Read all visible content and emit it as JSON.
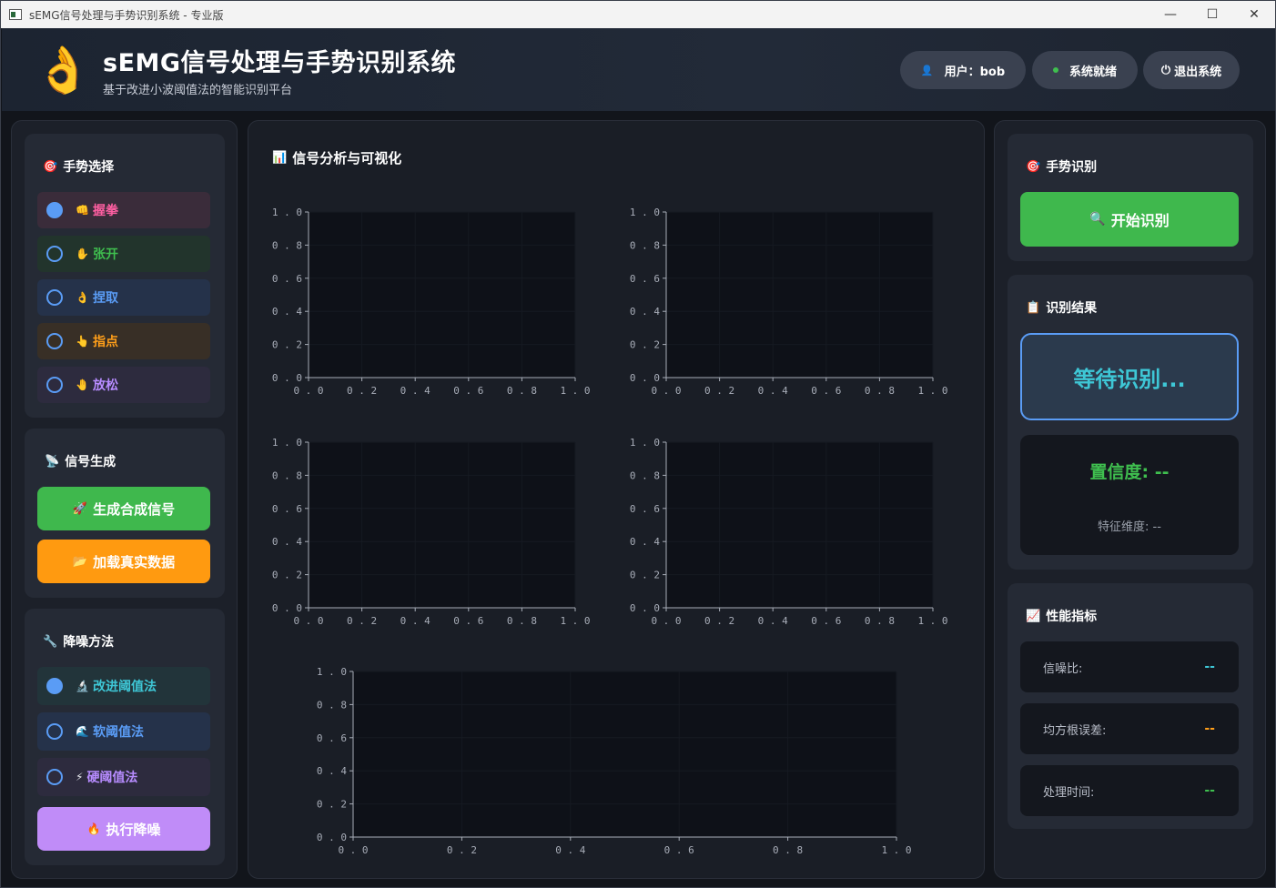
{
  "window": {
    "title": "sEMG信号处理与手势识别系统 - 专业版",
    "minimize": "—",
    "maximize": "☐",
    "close": "✕"
  },
  "header": {
    "logo": "👌",
    "title": "sEMG信号处理与手势识别系统",
    "subtitle": "基于改进小波阈值法的智能识别平台",
    "user_icon": "👤",
    "user": "用户：bob",
    "status": "系统就绪",
    "logout_icon": "⏻",
    "logout": "退出系统"
  },
  "gesture_select": {
    "icon": "🎯",
    "title": "手势选择",
    "items": [
      {
        "icon": "👊",
        "label": "握拳",
        "checked": true,
        "color": "#ff5fa2"
      },
      {
        "icon": "✋",
        "label": "张开",
        "checked": false,
        "color": "#3fbf4f"
      },
      {
        "icon": "👌",
        "label": "捏取",
        "checked": false,
        "color": "#5a9cf5"
      },
      {
        "icon": "👆",
        "label": "指点",
        "checked": false,
        "color": "#ff9f1a"
      },
      {
        "icon": "🤚",
        "label": "放松",
        "checked": false,
        "color": "#b78cff"
      }
    ]
  },
  "signal_gen": {
    "icon": "📡",
    "title": "信号生成",
    "gen_icon": "🚀",
    "gen_label": "生成合成信号",
    "load_icon": "📂",
    "load_label": "加载真实数据"
  },
  "denoise": {
    "icon": "🔧",
    "title": "降噪方法",
    "items": [
      {
        "icon": "🔬",
        "label": "改进阈值法",
        "checked": true,
        "color": "#3ec7d6"
      },
      {
        "icon": "🌊",
        "label": "软阈值法",
        "checked": false,
        "color": "#5a9cf5"
      },
      {
        "icon": "⚡",
        "label": "硬阈值法",
        "checked": false,
        "color": "#b78cff"
      }
    ],
    "run_icon": "🔥",
    "run_label": "执行降噪"
  },
  "plots": {
    "icon": "📊",
    "title": "信号分析与可视化",
    "ticks": [
      "0.0",
      "0.2",
      "0.4",
      "0.6",
      "0.8",
      "1.0"
    ]
  },
  "recognition": {
    "icon": "🎯",
    "title": "手势识别",
    "start_icon": "🔍",
    "start_label": "开始识别"
  },
  "result": {
    "icon": "📋",
    "title": "识别结果",
    "status": "等待识别...",
    "confidence": "置信度: --",
    "feature_dim": "特征维度: --"
  },
  "performance": {
    "icon": "📈",
    "title": "性能指标",
    "metrics": [
      {
        "label": "信噪比:",
        "value": "--",
        "color": "#3ec7d6"
      },
      {
        "label": "均方根误差:",
        "value": "--",
        "color": "#ff9f1a"
      },
      {
        "label": "处理时间:",
        "value": "--",
        "color": "#3fbf4f"
      }
    ]
  }
}
